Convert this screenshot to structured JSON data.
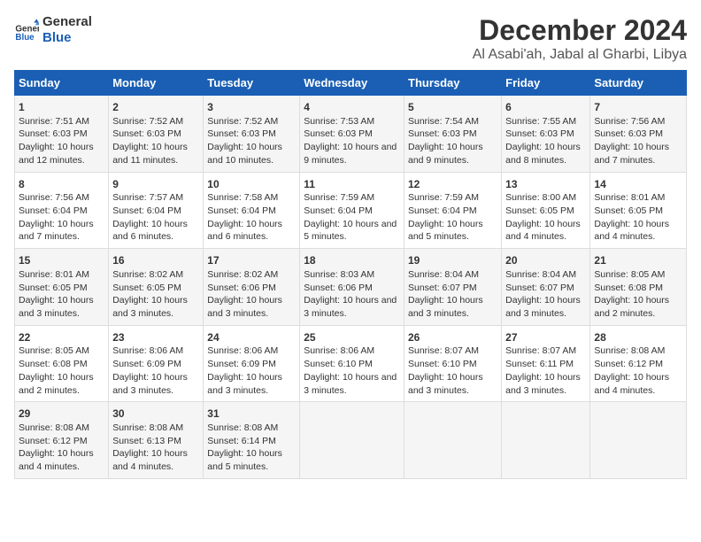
{
  "logo": {
    "line1": "General",
    "line2": "Blue"
  },
  "title": "December 2024",
  "subtitle": "Al Asabi'ah, Jabal al Gharbi, Libya",
  "days_of_week": [
    "Sunday",
    "Monday",
    "Tuesday",
    "Wednesday",
    "Thursday",
    "Friday",
    "Saturday"
  ],
  "weeks": [
    [
      {
        "day": 1,
        "sunrise": "7:51 AM",
        "sunset": "6:03 PM",
        "daylight": "10 hours and 12 minutes."
      },
      {
        "day": 2,
        "sunrise": "7:52 AM",
        "sunset": "6:03 PM",
        "daylight": "10 hours and 11 minutes."
      },
      {
        "day": 3,
        "sunrise": "7:52 AM",
        "sunset": "6:03 PM",
        "daylight": "10 hours and 10 minutes."
      },
      {
        "day": 4,
        "sunrise": "7:53 AM",
        "sunset": "6:03 PM",
        "daylight": "10 hours and 9 minutes."
      },
      {
        "day": 5,
        "sunrise": "7:54 AM",
        "sunset": "6:03 PM",
        "daylight": "10 hours and 9 minutes."
      },
      {
        "day": 6,
        "sunrise": "7:55 AM",
        "sunset": "6:03 PM",
        "daylight": "10 hours and 8 minutes."
      },
      {
        "day": 7,
        "sunrise": "7:56 AM",
        "sunset": "6:03 PM",
        "daylight": "10 hours and 7 minutes."
      }
    ],
    [
      {
        "day": 8,
        "sunrise": "7:56 AM",
        "sunset": "6:04 PM",
        "daylight": "10 hours and 7 minutes."
      },
      {
        "day": 9,
        "sunrise": "7:57 AM",
        "sunset": "6:04 PM",
        "daylight": "10 hours and 6 minutes."
      },
      {
        "day": 10,
        "sunrise": "7:58 AM",
        "sunset": "6:04 PM",
        "daylight": "10 hours and 6 minutes."
      },
      {
        "day": 11,
        "sunrise": "7:59 AM",
        "sunset": "6:04 PM",
        "daylight": "10 hours and 5 minutes."
      },
      {
        "day": 12,
        "sunrise": "7:59 AM",
        "sunset": "6:04 PM",
        "daylight": "10 hours and 5 minutes."
      },
      {
        "day": 13,
        "sunrise": "8:00 AM",
        "sunset": "6:05 PM",
        "daylight": "10 hours and 4 minutes."
      },
      {
        "day": 14,
        "sunrise": "8:01 AM",
        "sunset": "6:05 PM",
        "daylight": "10 hours and 4 minutes."
      }
    ],
    [
      {
        "day": 15,
        "sunrise": "8:01 AM",
        "sunset": "6:05 PM",
        "daylight": "10 hours and 3 minutes."
      },
      {
        "day": 16,
        "sunrise": "8:02 AM",
        "sunset": "6:05 PM",
        "daylight": "10 hours and 3 minutes."
      },
      {
        "day": 17,
        "sunrise": "8:02 AM",
        "sunset": "6:06 PM",
        "daylight": "10 hours and 3 minutes."
      },
      {
        "day": 18,
        "sunrise": "8:03 AM",
        "sunset": "6:06 PM",
        "daylight": "10 hours and 3 minutes."
      },
      {
        "day": 19,
        "sunrise": "8:04 AM",
        "sunset": "6:07 PM",
        "daylight": "10 hours and 3 minutes."
      },
      {
        "day": 20,
        "sunrise": "8:04 AM",
        "sunset": "6:07 PM",
        "daylight": "10 hours and 3 minutes."
      },
      {
        "day": 21,
        "sunrise": "8:05 AM",
        "sunset": "6:08 PM",
        "daylight": "10 hours and 2 minutes."
      }
    ],
    [
      {
        "day": 22,
        "sunrise": "8:05 AM",
        "sunset": "6:08 PM",
        "daylight": "10 hours and 2 minutes."
      },
      {
        "day": 23,
        "sunrise": "8:06 AM",
        "sunset": "6:09 PM",
        "daylight": "10 hours and 3 minutes."
      },
      {
        "day": 24,
        "sunrise": "8:06 AM",
        "sunset": "6:09 PM",
        "daylight": "10 hours and 3 minutes."
      },
      {
        "day": 25,
        "sunrise": "8:06 AM",
        "sunset": "6:10 PM",
        "daylight": "10 hours and 3 minutes."
      },
      {
        "day": 26,
        "sunrise": "8:07 AM",
        "sunset": "6:10 PM",
        "daylight": "10 hours and 3 minutes."
      },
      {
        "day": 27,
        "sunrise": "8:07 AM",
        "sunset": "6:11 PM",
        "daylight": "10 hours and 3 minutes."
      },
      {
        "day": 28,
        "sunrise": "8:08 AM",
        "sunset": "6:12 PM",
        "daylight": "10 hours and 4 minutes."
      }
    ],
    [
      {
        "day": 29,
        "sunrise": "8:08 AM",
        "sunset": "6:12 PM",
        "daylight": "10 hours and 4 minutes."
      },
      {
        "day": 30,
        "sunrise": "8:08 AM",
        "sunset": "6:13 PM",
        "daylight": "10 hours and 4 minutes."
      },
      {
        "day": 31,
        "sunrise": "8:08 AM",
        "sunset": "6:14 PM",
        "daylight": "10 hours and 5 minutes."
      },
      null,
      null,
      null,
      null
    ]
  ]
}
